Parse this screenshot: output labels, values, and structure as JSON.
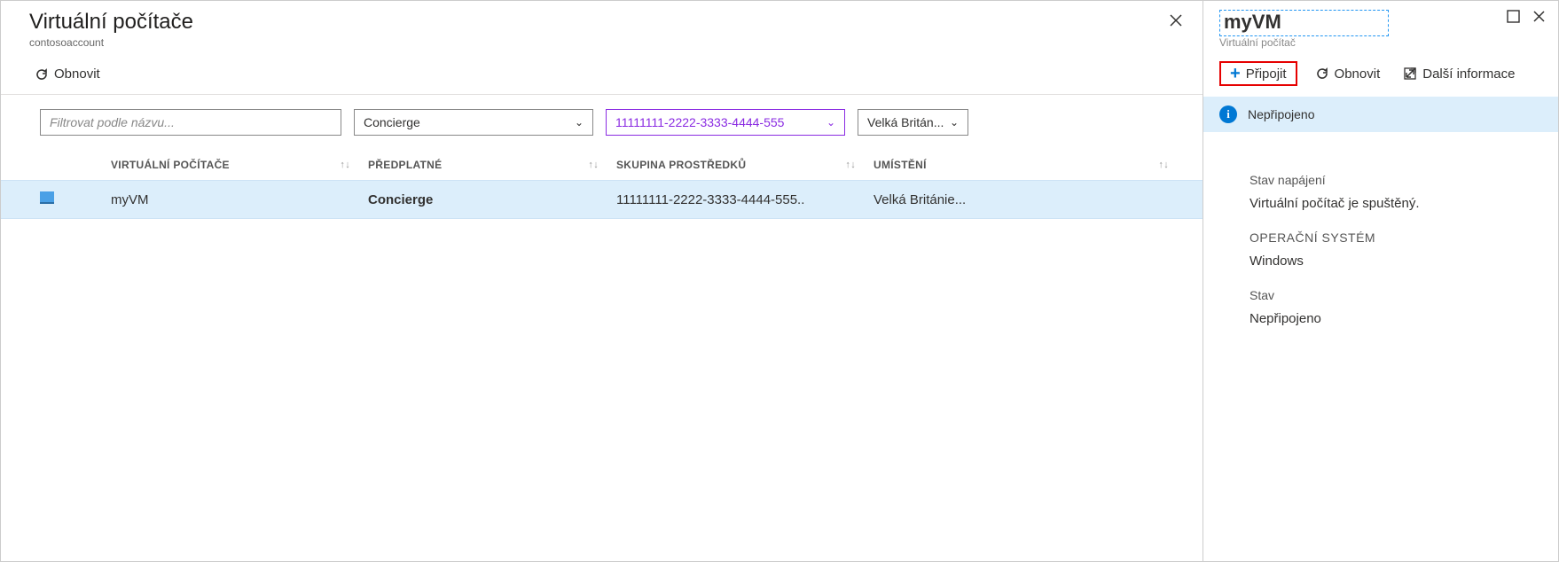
{
  "left": {
    "title": "Virtuální počítače",
    "subtitle": "contosoaccount",
    "refresh_label": "Obnovit",
    "filter_placeholder": "Filtrovat podle názvu...",
    "subscription_filter": "Concierge",
    "resource_group_filter": "11111111-2222-3333-4444-555",
    "location_filter": "Velká Britán...",
    "columns": {
      "name": "Virtuální počítače",
      "subscription": "Předplatné",
      "resource_group": "Skupina prostředků",
      "location": "Umístění"
    },
    "rows": [
      {
        "name": "myVM",
        "subscription": "Concierge",
        "resource_group": "11111111-2222-3333-4444-555..",
        "location": "Velká Británie..."
      }
    ]
  },
  "right": {
    "title": "myVM",
    "subtitle": "Virtuální počítač",
    "connect_label": "Připojit",
    "refresh_label": "Obnovit",
    "more_info_label": "Další informace",
    "info_bar": "Nepřipojeno",
    "power_label": "Stav napájení",
    "power_value": "Virtuální počítač je spuštěný.",
    "os_label": "Operační systém",
    "os_value": "Windows",
    "status_label": "Stav",
    "status_value": "Nepřipojeno"
  }
}
